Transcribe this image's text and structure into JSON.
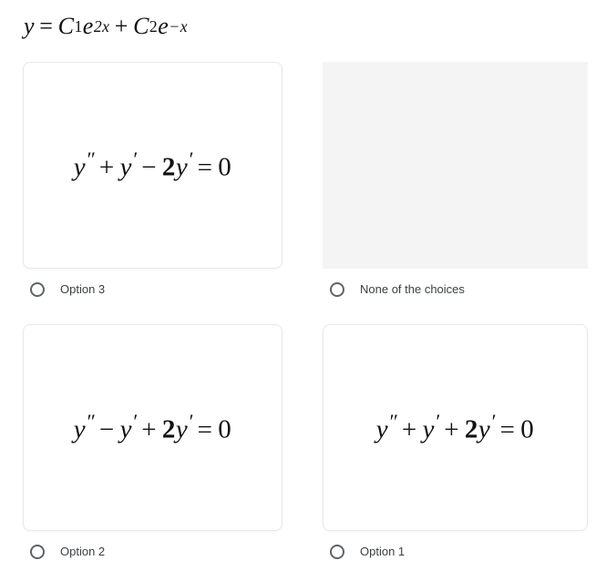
{
  "question": {
    "prompt_equation_text": "y = C₁e^(2x) + C₂e^(−x)"
  },
  "options": [
    {
      "id": "option-3",
      "equation_text": "y″ + y′ − 2y′ = 0",
      "label": "Option 3",
      "selected": false,
      "blank": false,
      "position": "row1-col1"
    },
    {
      "id": "none-of-the-choices",
      "equation_text": "",
      "label": "None of the choices",
      "selected": false,
      "blank": true,
      "position": "row1-col2"
    },
    {
      "id": "option-2",
      "equation_text": "y″ − y′ + 2y′ = 0",
      "label": "Option 2",
      "selected": false,
      "blank": false,
      "position": "row2-col1"
    },
    {
      "id": "option-1",
      "equation_text": "y″ + y′ + 2y′ = 0",
      "label": "Option 1",
      "selected": false,
      "blank": false,
      "position": "row2-col2"
    }
  ],
  "colors": {
    "page_background": "#ffffff",
    "card_border": "#e8e8e8",
    "blank_card_fill": "#f4f4f4",
    "radio_ring": "#5f6368",
    "label_text": "#3c4043",
    "equation_text": "#111111"
  }
}
